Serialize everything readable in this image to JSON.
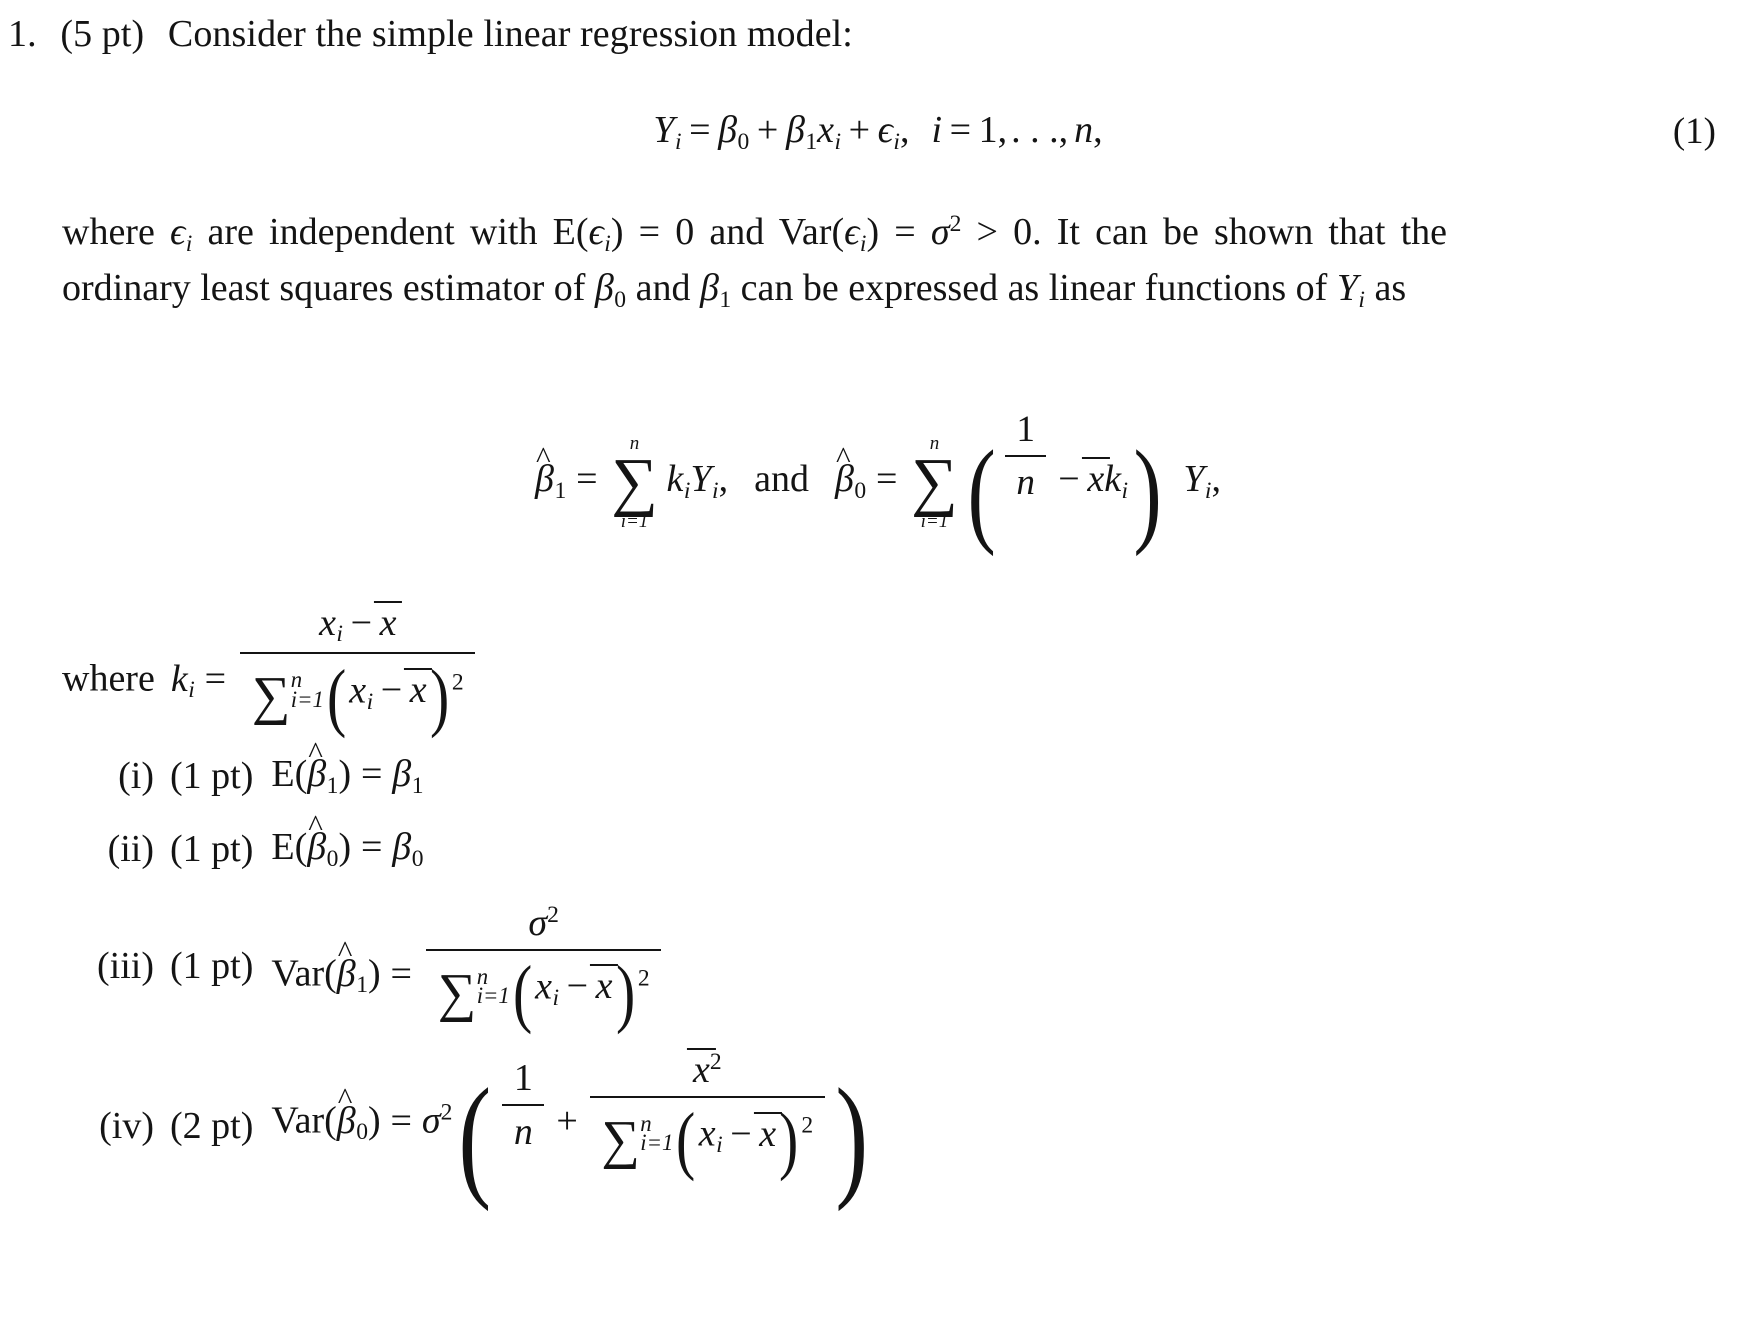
{
  "document": {
    "type": "math-homework",
    "problem_number": "1.",
    "problem_points": "(5 pt)",
    "problem_statement": "Consider the simple linear regression model:",
    "equation_tag": "(1)",
    "equation_1": {
      "lhs_var": "Y",
      "lhs_sub": "i",
      "beta0": "β",
      "beta0_sub": "0",
      "beta1": "β",
      "beta1_sub": "1",
      "x_var": "x",
      "x_sub": "i",
      "error": "ϵ",
      "error_sub": "i",
      "index_var": "i",
      "range_start": "1",
      "ellipsis": ". . .",
      "range_end": "n",
      "plus": "+",
      "equals": "=",
      "comma": ","
    },
    "paragraph": {
      "part1": "where ",
      "eps": "ϵ",
      "eps_sub": "i",
      "part2": " are independent with E(",
      "part3": ") = 0 and Var(",
      "sigma": "σ",
      "sigma_exp": "2",
      "part4": ") = ",
      "part5": " > 0. It can be shown that the ordinary least squares estimator of ",
      "beta": "β",
      "beta0_sub": "0",
      "beta1_sub": "1",
      "part6": " and ",
      "part7": " can be expressed as linear functions of ",
      "Y": "Y",
      "Y_sub": "i",
      "part8": " as"
    },
    "display_estimators": {
      "beta1_hat": "β",
      "beta1_hat_sub": "1",
      "hat_mark": "^",
      "equals": "=",
      "sum_symbol": "∑",
      "sum_upper": "n",
      "sum_lower": "i=1",
      "k": "k",
      "k_sub": "i",
      "Y": "Y",
      "Y_sub": "i",
      "conjunction": "and",
      "beta0_hat": "β",
      "beta0_hat_sub": "0",
      "one": "1",
      "n": "n",
      "minus": "−",
      "xbar": "x",
      "comma": ",",
      "paren_open": "(",
      "paren_close": ")"
    },
    "k_definition": {
      "prefix": "where",
      "k": "k",
      "k_sub": "i",
      "equals": "=",
      "numerator_x": "x",
      "numerator_sub": "i",
      "numerator_minus": "−",
      "numerator_xbar": "x",
      "denominator_sum": "∑",
      "denominator_upper": "n",
      "denominator_lower": "i=1",
      "denominator_x": "x",
      "denominator_sub": "i",
      "denominator_xbar": "x",
      "denominator_exp": "2"
    },
    "items": [
      {
        "label": "(i)",
        "points": "(1 pt)",
        "operator": "E",
        "arg_var": "β",
        "arg_sub": "1",
        "equals": "=",
        "rhs_var": "β",
        "rhs_sub": "1",
        "kind": "simple"
      },
      {
        "label": "(ii)",
        "points": "(1 pt)",
        "operator": "E",
        "arg_var": "β",
        "arg_sub": "0",
        "equals": "=",
        "rhs_var": "β",
        "rhs_sub": "0",
        "kind": "simple"
      },
      {
        "label": "(iii)",
        "points": "(1 pt)",
        "operator": "Var",
        "arg_var": "β",
        "arg_sub": "1",
        "equals": "=",
        "num_sigma": "σ",
        "num_exp": "2",
        "den_sum": "∑",
        "den_upper": "n",
        "den_lower": "i=1",
        "den_x": "x",
        "den_sub": "i",
        "den_minus": "−",
        "den_xbar": "x",
        "den_exp": "2",
        "kind": "fraction"
      },
      {
        "label": "(iv)",
        "points": "(2 pt)",
        "operator": "Var",
        "arg_var": "β",
        "arg_sub": "0",
        "equals": "=",
        "sigma": "σ",
        "sigma_exp": "2",
        "one": "1",
        "n": "n",
        "plus": "+",
        "num_xbar": "x",
        "num_exp": "2",
        "den_sum": "∑",
        "den_upper": "n",
        "den_lower": "i=1",
        "den_x": "x",
        "den_sub": "i",
        "den_minus": "−",
        "den_xbar": "x",
        "den_exp": "2",
        "kind": "big-fraction"
      }
    ]
  },
  "colors": {
    "text": "#141414",
    "background": "#ffffff"
  }
}
